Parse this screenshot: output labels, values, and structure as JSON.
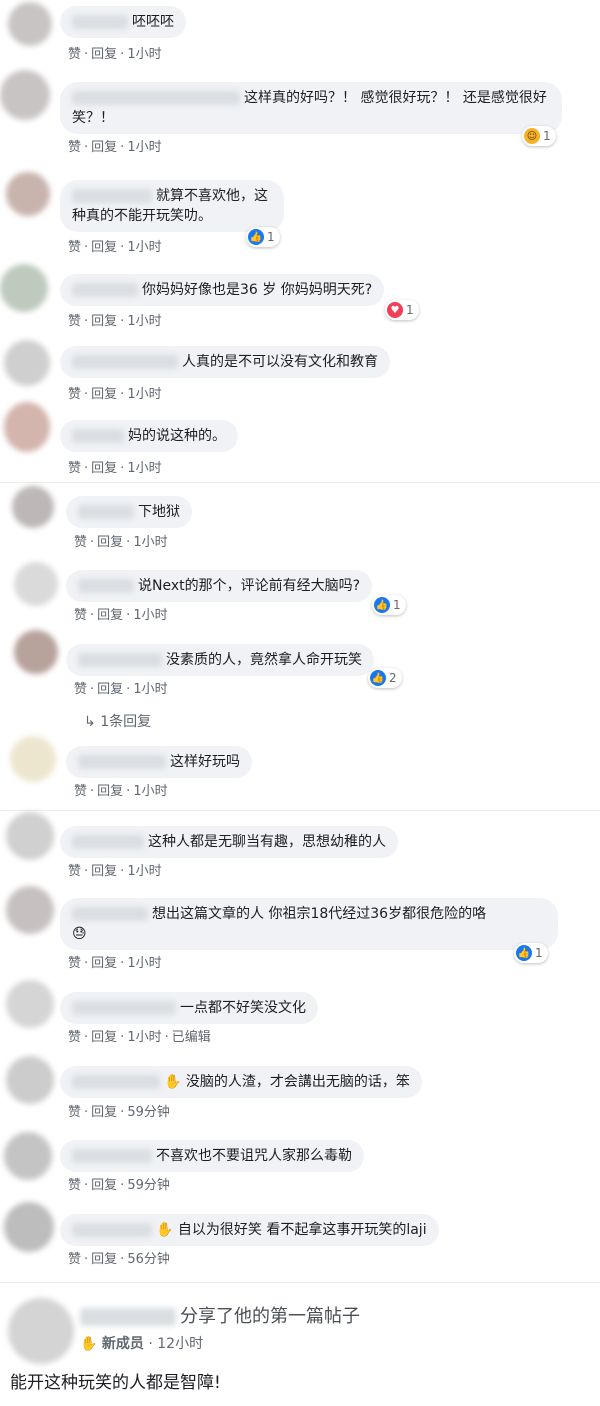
{
  "action_like": "赞",
  "action_reply": "回复",
  "dot": "·",
  "comments": [
    {
      "text": "呸呸呸",
      "time": "1小时"
    },
    {
      "text": "这样真的好吗？！ 感觉很好玩？！ 还是感觉很好笑？！",
      "time": "1小时",
      "reaction": {
        "type": "haha",
        "icon": "haha-icon",
        "count": "1"
      }
    },
    {
      "text": "就算不喜欢他，这种真的不能开玩笑叻。",
      "time": "1小时",
      "reaction": {
        "type": "like",
        "icon": "like-icon",
        "count": "1"
      }
    },
    {
      "text": "你妈妈好像也是36 岁 你妈妈明天死?",
      "time": "1小时",
      "reaction": {
        "type": "love",
        "icon": "heart-icon",
        "count": "1"
      }
    },
    {
      "text": "人真的是不可以没有文化和教育",
      "time": "1小时"
    },
    {
      "text": "妈的说这种的。",
      "time": "1小时"
    },
    {
      "text": "下地狱",
      "time": "1小时"
    },
    {
      "text": "说Next的那个，评论前有经大脑吗?",
      "time": "1小时",
      "reaction": {
        "type": "like",
        "icon": "like-icon",
        "count": "1"
      }
    },
    {
      "text": "没素质的人，竟然拿人命开玩笑",
      "time": "1小时",
      "reaction": {
        "type": "like",
        "icon": "like-icon",
        "count": "2"
      },
      "replies_label": "1条回复"
    },
    {
      "text": "这样好玩吗",
      "time": "1小时"
    },
    {
      "text": "这种人都是无聊当有趣，思想幼稚的人",
      "time": "1小时"
    },
    {
      "text": "想出这篇文章的人 你祖宗18代经过36岁都很危险的咯",
      "time": "1小时",
      "emoji": "😓",
      "reaction": {
        "type": "like",
        "icon": "like-icon",
        "count": "1"
      }
    },
    {
      "text": "一点都不好笑没文化",
      "time": "1小时",
      "edited": "已编辑"
    },
    {
      "text": "没脑的人渣，才会講出无脑的话，笨",
      "time": "59分钟",
      "badge": "wave-icon"
    },
    {
      "text": "不喜欢也不要诅咒人家那么毒勒",
      "time": "59分钟"
    },
    {
      "text": "自以为很好笑 看不起拿这事开玩笑的laji",
      "time": "56分钟",
      "badge": "wave-icon"
    }
  ],
  "post": {
    "share_text": "分享了他的第一篇帖子",
    "member_label": "新成员",
    "member_time": "12小时",
    "body": "能开这种玩笑的人都是智障!"
  },
  "colors": {
    "like": "#1877f2",
    "love": "#f33e58",
    "haha": "#f7b125",
    "bubble": "#f0f2f5"
  }
}
